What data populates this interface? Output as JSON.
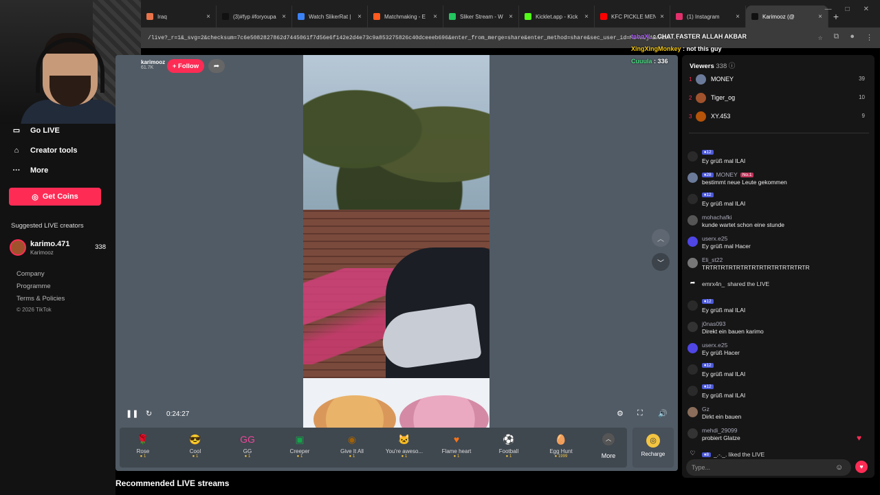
{
  "tabs": [
    {
      "title": "Iraq",
      "color": "#e8734a"
    },
    {
      "title": "(3)#fyp #foryoupa",
      "color": "#111"
    },
    {
      "title": "Watch SlikerRat |",
      "color": "#3b82f6"
    },
    {
      "title": "Matchmaking - E",
      "color": "#ff5a1f"
    },
    {
      "title": "Sliker Stream - W",
      "color": "#22c55e"
    },
    {
      "title": "Kicklet.app - Kick",
      "color": "#53fc18"
    },
    {
      "title": "KFC PICKLE MENU",
      "color": "#ff0000"
    },
    {
      "title": "(1) Instagram",
      "color": "#e1306c"
    },
    {
      "title": "Karimooz (@",
      "color": "#111",
      "active": true
    }
  ],
  "address": "/live?_r=1&_svg=2&checksum=7c6e5082827862d7445061f7d56e6f142e2d4e73c9a853275826c40dceeeb696&enter_from_merge=share&enter_method=share&sec_user_id=MS4wLjABAAAA...",
  "sidebar": {
    "nav": [
      {
        "label": "Go LIVE",
        "icon": "camera-icon"
      },
      {
        "label": "Creator tools",
        "icon": "home-icon"
      },
      {
        "label": "More",
        "icon": "more-icon"
      }
    ],
    "coins_label": "Get Coins",
    "suggested_title": "Suggested LIVE creators",
    "creator": {
      "name": "karimo.471",
      "sub": "Karimooz",
      "count": "338"
    },
    "links": [
      "Company",
      "Programme",
      "Terms & Policies"
    ],
    "copyright": "© 2026 TikTok"
  },
  "stream": {
    "host": "karimooz",
    "fans": "61.7K",
    "follow_label": "+ Follow",
    "time": "0:24:27"
  },
  "gifts": [
    {
      "name": "Rose",
      "price": "1",
      "color": "#e11d48",
      "glyph": "🌹"
    },
    {
      "name": "Cool",
      "price": "1",
      "color": "#f59e0b",
      "glyph": "😎"
    },
    {
      "name": "GG",
      "price": "1",
      "color": "#ec4899",
      "glyph": "GG"
    },
    {
      "name": "Creeper",
      "price": "1",
      "color": "#16a34a",
      "glyph": "▣"
    },
    {
      "name": "Give It All",
      "price": "1",
      "color": "#a16207",
      "glyph": "◉"
    },
    {
      "name": "You're aweso...",
      "price": "1",
      "color": "#d6b48a",
      "glyph": "🐱"
    },
    {
      "name": "Flame heart",
      "price": "1",
      "color": "#f97316",
      "glyph": "♥"
    },
    {
      "name": "Football",
      "price": "1",
      "color": "#e5e7eb",
      "glyph": "⚽"
    },
    {
      "name": "Egg Hunt",
      "price": "1999",
      "color": "#84cc16",
      "glyph": "🥚"
    }
  ],
  "gift_more": "More",
  "recharge": "Recharge",
  "recommended_title": "Recommended LIVE streams",
  "overlay_chat": [
    {
      "user": "taboXL",
      "text": "CHAT FASTER ALLAH AKBAR",
      "color": "#a855f7"
    },
    {
      "user": "XingXingMonkey",
      "text": "not this guy",
      "color": "#facc15"
    },
    {
      "user": "Cuuula",
      "text": "336",
      "color": "#4ade80"
    }
  ],
  "chat": {
    "viewers_label": "Viewers",
    "viewers_count": "338",
    "top_viewers": [
      {
        "rank": "1",
        "name": "MONEY",
        "score": "39",
        "color": "#6b7a99"
      },
      {
        "rank": "2",
        "name": "Tiger_og",
        "score": "10",
        "color": "#a0522d"
      },
      {
        "rank": "3",
        "name": "XY.453",
        "score": "9",
        "color": "#b45309"
      }
    ],
    "messages": [
      {
        "user": "",
        "badge": "12",
        "text": "Ey grüß mal ILAI",
        "color": "#2a2a2a"
      },
      {
        "user": "MONEY",
        "badge": "28",
        "extra": "No.1",
        "text": "bestimmt neue Leute gekommen",
        "color": "#6b7a99"
      },
      {
        "user": "",
        "badge": "12",
        "text": "Ey grüß mal ILAI",
        "color": "#2a2a2a"
      },
      {
        "user": "mohachafki",
        "text": "kunde wartet schon eine stunde",
        "color": "#555"
      },
      {
        "user": "userx.e25",
        "text": "Ey grüß mal Hacer",
        "color": "#4f46e5"
      },
      {
        "user": "Eli_st22",
        "text": "TRTRTRTRTRTRTRTRTRTRTRTRTRTR",
        "color": "#777"
      },
      {
        "user": "emrx4n_",
        "text": "shared the LIVE",
        "color": "#333",
        "share": true
      },
      {
        "user": "",
        "badge": "12",
        "text": "Ey grüß mal ILAI",
        "color": "#2a2a2a"
      },
      {
        "user": "j0nas093",
        "text": "Direkt ein bauen karimo",
        "color": "#333"
      },
      {
        "user": "userx.e25",
        "text": "Ey grüß Hacer",
        "color": "#4f46e5"
      },
      {
        "user": "",
        "badge": "12",
        "text": "Ey grüß mal ILAI",
        "color": "#2a2a2a"
      },
      {
        "user": "",
        "badge": "12",
        "text": "Ey grüß mal ILAI",
        "color": "#2a2a2a"
      },
      {
        "user": "Gz",
        "text": "Dirkt ein bauen",
        "color": "#8a6d5a"
      },
      {
        "user": "mehdi_29099",
        "text": "probiert Glatze",
        "color": "#333"
      },
      {
        "user": "",
        "badge": "8",
        "text": "_.-._. liked the LIVE",
        "color": "#333",
        "like": true
      }
    ],
    "input_placeholder": "Type..."
  }
}
